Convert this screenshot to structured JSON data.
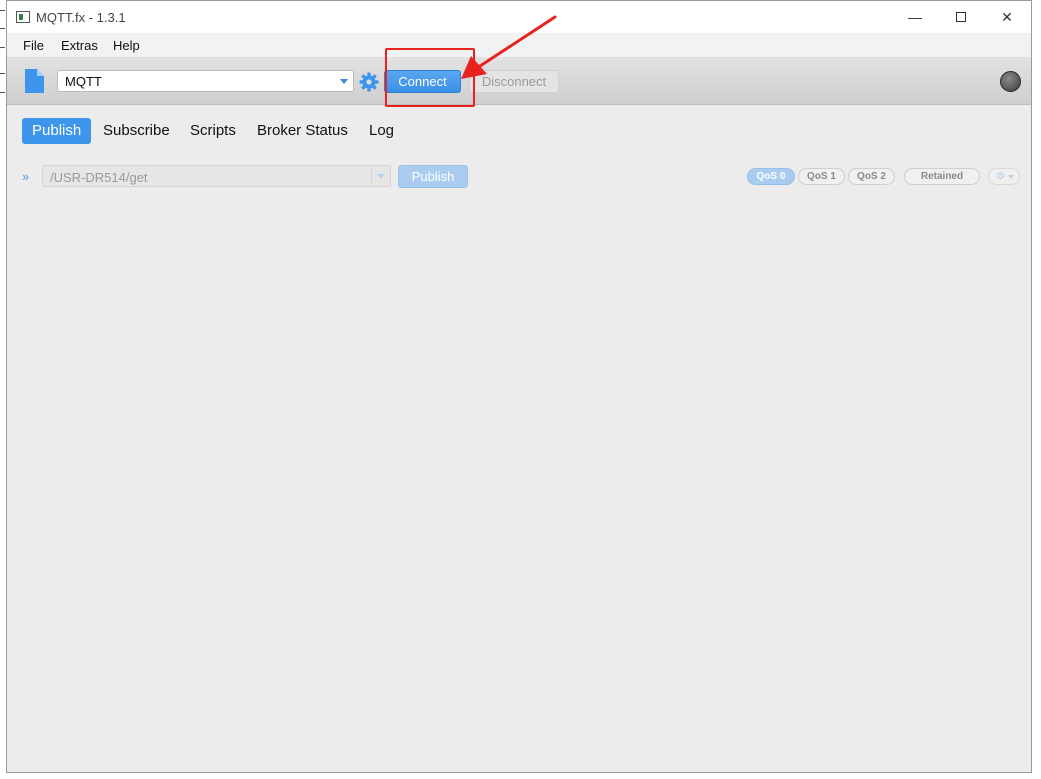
{
  "window": {
    "title": "MQTT.fx - 1.3.1",
    "controls": {
      "minimize": "—",
      "close": "✕"
    }
  },
  "menu": {
    "items": [
      "File",
      "Extras",
      "Help"
    ]
  },
  "toolbar": {
    "profile": "MQTT",
    "connect_label": "Connect",
    "disconnect_label": "Disconnect",
    "status": "disconnected"
  },
  "tabs": [
    {
      "label": "Publish",
      "active": true
    },
    {
      "label": "Subscribe",
      "active": false
    },
    {
      "label": "Scripts",
      "active": false
    },
    {
      "label": "Broker Status",
      "active": false
    },
    {
      "label": "Log",
      "active": false
    }
  ],
  "publish": {
    "expand_icon": "»",
    "topic": "/USR-DR514/get",
    "publish_label": "Publish",
    "qos": [
      "QoS 0",
      "QoS 1",
      "QoS 2"
    ],
    "selected_qos": "QoS 0",
    "retained_label": "Retained",
    "options_icon": "⚙"
  },
  "colors": {
    "accent": "#3d95ec",
    "annotation": "#e8231f",
    "disabled_accent": "#a9ccf0"
  }
}
